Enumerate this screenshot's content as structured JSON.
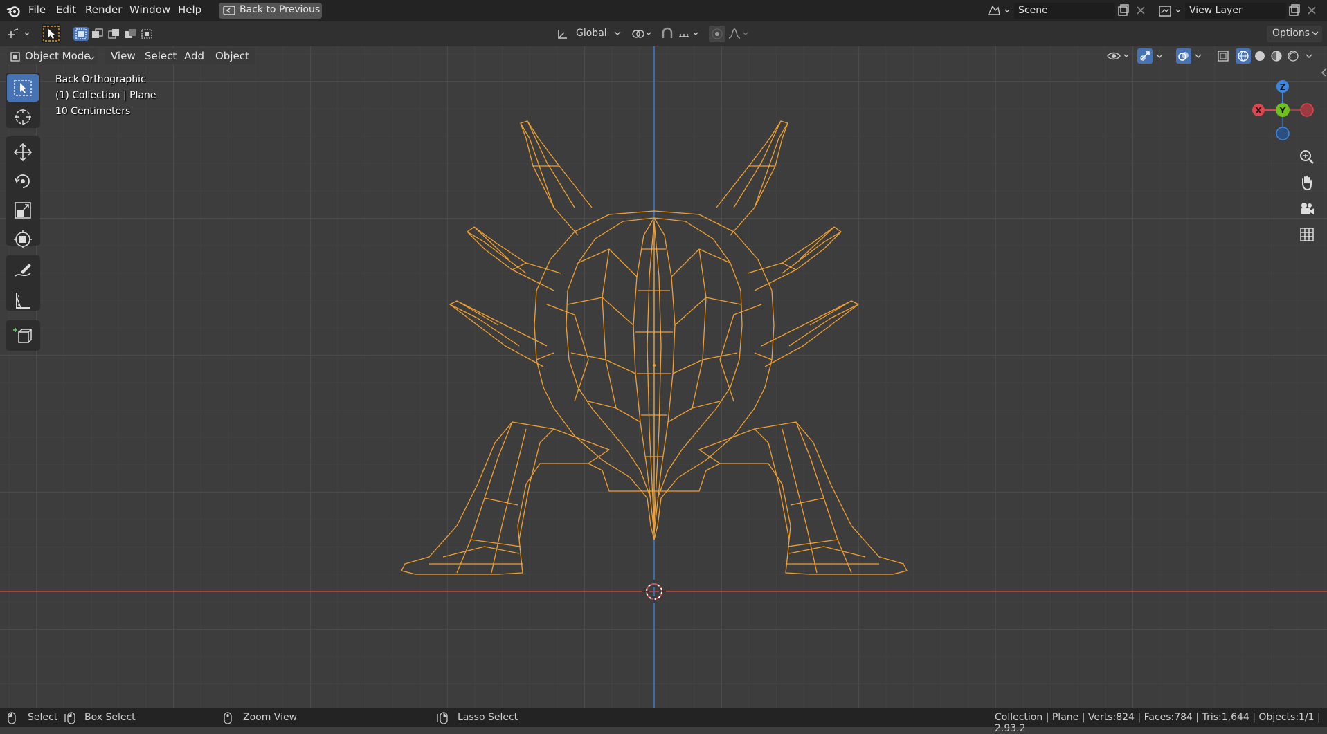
{
  "topbar": {
    "menus": [
      "File",
      "Edit",
      "Render",
      "Window",
      "Help"
    ],
    "back_button": "Back to Previous",
    "scene_label": "Scene",
    "view_layer_label": "View Layer"
  },
  "tool_header": {
    "orientation": "Global",
    "options_label": "Options"
  },
  "viewport_header": {
    "mode": "Object Mode",
    "menus": [
      "View",
      "Select",
      "Add",
      "Object"
    ]
  },
  "viewport": {
    "view_name": "Back Orthographic",
    "collection_info": "(1) Collection | Plane",
    "scale_info": "10 Centimeters",
    "gizmo": {
      "z": "Z",
      "y": "Y",
      "x": "X"
    },
    "mesh_color": "#f0a030",
    "x_axis_color": "#d04545",
    "z_axis_color": "#3a7bd5"
  },
  "toolbar": {
    "tools": [
      "select-box",
      "cursor",
      "move",
      "rotate",
      "scale",
      "transform",
      "annotate",
      "measure",
      "add-cube"
    ]
  },
  "statusbar": {
    "select": "Select",
    "box_select": "Box Select",
    "zoom_view": "Zoom View",
    "lasso_select": "Lasso Select",
    "stats": "Collection | Plane | Verts:824 | Faces:784 | Tris:1,644 | Objects:1/1 | 2.93.2"
  },
  "colors": {
    "accent": "#4772b3",
    "gizmo_x": "#e0464f",
    "gizmo_y": "#6fbf1f",
    "gizmo_z": "#3b86e0"
  }
}
